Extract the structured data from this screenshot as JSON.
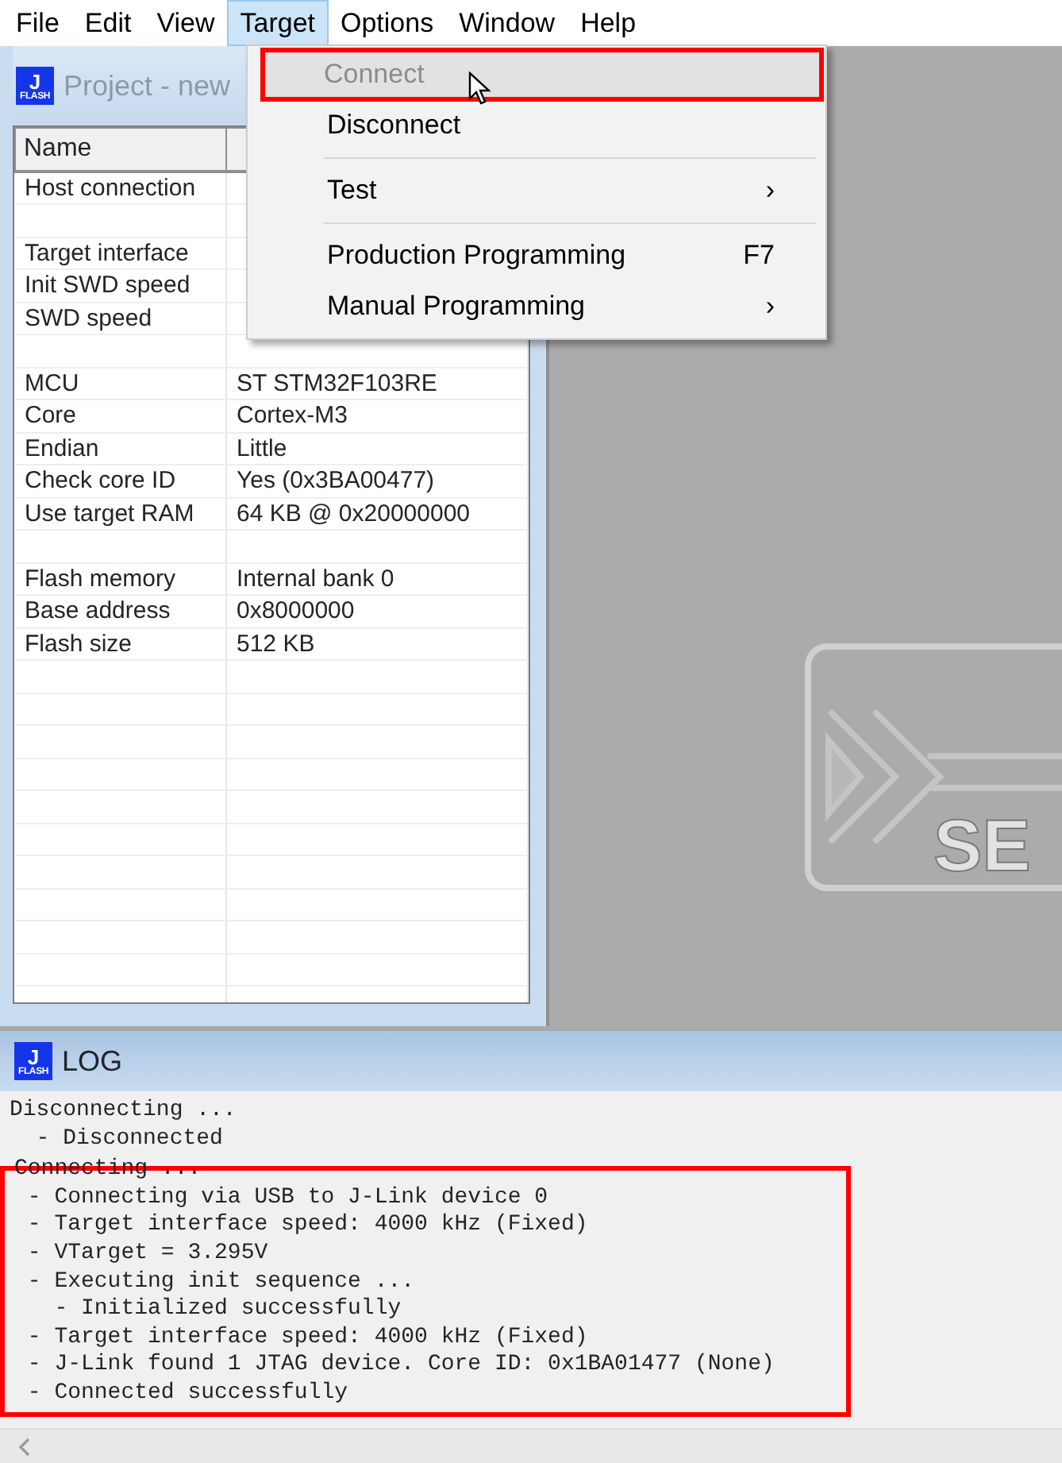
{
  "menubar": [
    {
      "label": "File",
      "selected": false
    },
    {
      "label": "Edit",
      "selected": false
    },
    {
      "label": "View",
      "selected": false
    },
    {
      "label": "Target",
      "selected": true
    },
    {
      "label": "Options",
      "selected": false
    },
    {
      "label": "Window",
      "selected": false
    },
    {
      "label": "Help",
      "selected": false
    }
  ],
  "menu": [
    {
      "kind": "item",
      "label": "Connect",
      "disabled": true,
      "highlighted": true,
      "framed": true
    },
    {
      "kind": "item",
      "label": "Disconnect",
      "disabled": false,
      "highlighted": false,
      "framed": false
    },
    {
      "kind": "separator"
    },
    {
      "kind": "item",
      "label": "Test",
      "submenu": "›",
      "disabled": false,
      "highlighted": false,
      "framed": false
    },
    {
      "kind": "separator"
    },
    {
      "kind": "item",
      "label": "Production Programming",
      "shortcut": "F7",
      "disabled": false,
      "highlighted": false,
      "framed": false
    },
    {
      "kind": "item",
      "label": "Manual Programming",
      "submenu": "›",
      "disabled": false,
      "highlighted": false,
      "framed": false
    }
  ],
  "project_window": {
    "title": "Project - new",
    "active": false,
    "icon_text": "J",
    "icon_subtext": "FLASH",
    "columns": [
      "Name"
    ],
    "rows": [
      {
        "kind": "entry",
        "name": "Host connection"
      },
      {
        "kind": "blank"
      },
      {
        "kind": "entry",
        "name": "Target interface"
      },
      {
        "kind": "entry",
        "name": "Init SWD speed"
      },
      {
        "kind": "entry",
        "name": "SWD speed"
      },
      {
        "kind": "blank"
      },
      {
        "kind": "entry",
        "name": "MCU",
        "value": "ST STM32F103RE"
      },
      {
        "kind": "entry",
        "name": "Core",
        "value": "Cortex-M3"
      },
      {
        "kind": "entry",
        "name": "Endian",
        "value": "Little"
      },
      {
        "kind": "entry",
        "name": "Check core ID",
        "value": "Yes (0x3BA00477)"
      },
      {
        "kind": "entry",
        "name": "Use target RAM",
        "value": "64 KB @ 0x20000000"
      },
      {
        "kind": "blank"
      },
      {
        "kind": "entry",
        "name": "Flash memory",
        "value": "Internal bank 0"
      },
      {
        "kind": "entry",
        "name": "Base address",
        "value": "0x8000000"
      },
      {
        "kind": "entry",
        "name": "Flash size",
        "value": "512 KB"
      }
    ]
  },
  "logo": {
    "text": "SE"
  },
  "log_window": {
    "title": "LOG",
    "active": true,
    "icon_text": "J",
    "icon_subtext": "FLASH",
    "blocks": [
      {
        "framed": false,
        "lines": [
          "Disconnecting ...",
          "  - Disconnected"
        ]
      },
      {
        "framed": true,
        "lines": [
          "Connecting ...",
          " - Connecting via USB to J-Link device 0",
          " - Target interface speed: 4000 kHz (Fixed)",
          " - VTarget = 3.295V",
          " - Executing init sequence ...",
          "   - Initialized successfully",
          " - Target interface speed: 4000 kHz (Fixed)",
          " - J-Link found 1 JTAG device. Core ID: 0x1BA01477 (None)",
          " - Connected successfully"
        ]
      }
    ]
  }
}
